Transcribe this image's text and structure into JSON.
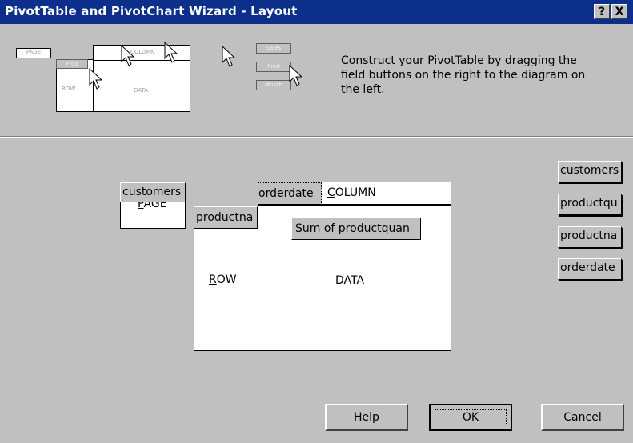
{
  "window": {
    "title": "PivotTable and PivotChart Wizard - Layout"
  },
  "titlebar_buttons": {
    "help": "?",
    "close": "X"
  },
  "illustration": {
    "page": "PAGE",
    "column": "COLUMN",
    "row": "ROW",
    "data": "DATA",
    "prod_row_btn": "Prod",
    "sales_btn": "Sales",
    "prod_btn": "Prod",
    "month_btn": "Month"
  },
  "instructions": "Construct your PivotTable by dragging the field buttons on the right to the diagram on the left.",
  "layout": {
    "page_area": {
      "label": "PAGE",
      "field": "customers"
    },
    "column_area": {
      "label": "COLUMN",
      "field": "orderdate"
    },
    "row_area": {
      "label": "ROW",
      "field": "productna"
    },
    "data_area": {
      "label": "DATA",
      "field": "Sum of productquan"
    }
  },
  "field_list": [
    "customers",
    "productqu",
    "productna",
    "orderdate"
  ],
  "buttons": {
    "help": "Help",
    "ok": "OK",
    "cancel": "Cancel"
  }
}
